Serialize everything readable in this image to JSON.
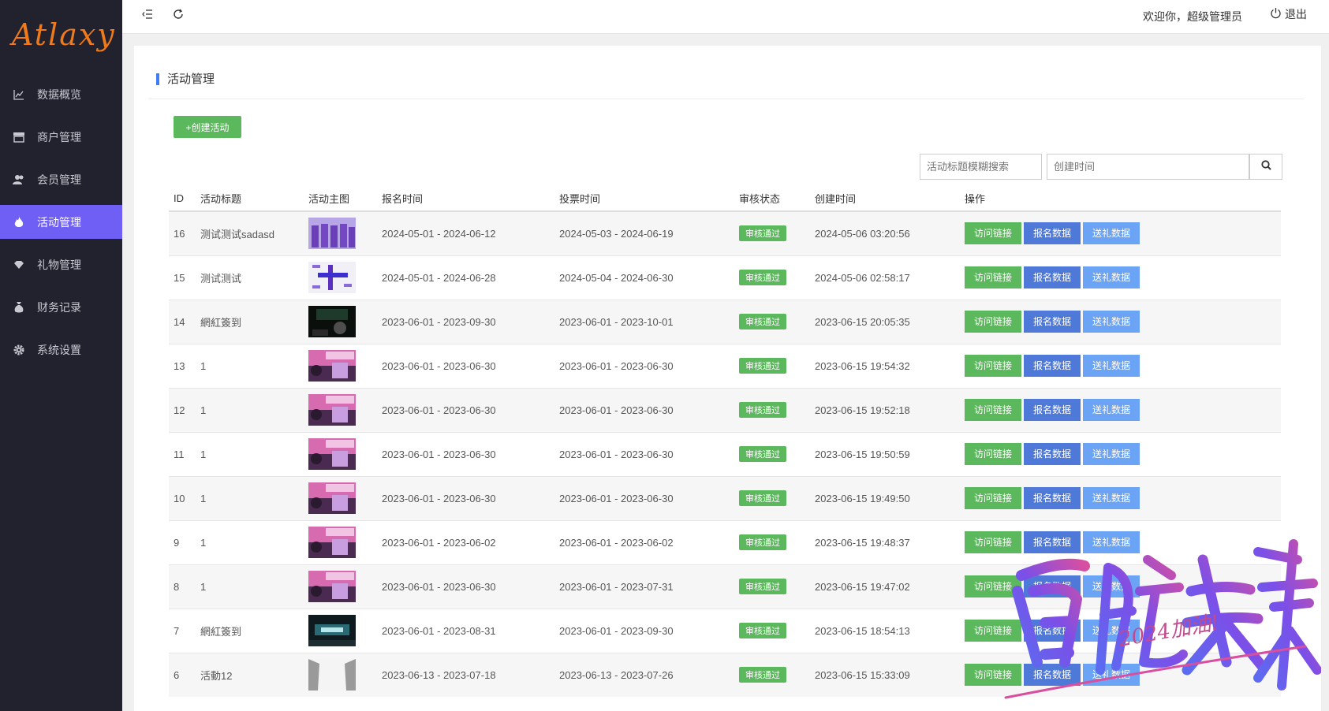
{
  "brand": "Atlaxy",
  "sidebar": {
    "items": [
      {
        "label": "数据概览",
        "icon": "chart-line-icon",
        "active": false
      },
      {
        "label": "商户管理",
        "icon": "store-icon",
        "active": false
      },
      {
        "label": "会员管理",
        "icon": "users-icon",
        "active": false
      },
      {
        "label": "活动管理",
        "icon": "fire-icon",
        "active": true
      },
      {
        "label": "礼物管理",
        "icon": "diamond-icon",
        "active": false
      },
      {
        "label": "财务记录",
        "icon": "money-bag-icon",
        "active": false
      },
      {
        "label": "系统设置",
        "icon": "gear-icon",
        "active": false
      }
    ]
  },
  "header": {
    "welcome": "欢迎你，超级管理员",
    "logout": "退出"
  },
  "page": {
    "title": "活动管理",
    "create_label": "+创建活动",
    "search_title_placeholder": "活动标题模糊搜索",
    "search_time_placeholder": "创建时间"
  },
  "table": {
    "columns": [
      "ID",
      "活动标题",
      "活动主图",
      "报名时间",
      "投票时间",
      "审核状态",
      "创建时间",
      "操作"
    ],
    "actions": [
      "访问链接",
      "报名数据",
      "送礼数据"
    ],
    "rows": [
      {
        "id": "16",
        "title": "测试测试sadasd",
        "thumb": "purple-group",
        "signup": "2024-05-01 - 2024-06-12",
        "vote": "2024-05-03 - 2024-06-19",
        "status": "审核通过",
        "created": "2024-05-06 03:20:56"
      },
      {
        "id": "15",
        "title": "测试测试",
        "thumb": "diagram",
        "signup": "2024-05-01 - 2024-06-28",
        "vote": "2024-05-04 - 2024-06-30",
        "status": "审核通过",
        "created": "2024-05-06 02:58:17"
      },
      {
        "id": "14",
        "title": "網紅簽到",
        "thumb": "dark-green",
        "signup": "2023-06-01 - 2023-09-30",
        "vote": "2023-06-01 - 2023-10-01",
        "status": "审核通过",
        "created": "2023-06-15 20:05:35"
      },
      {
        "id": "13",
        "title": "1",
        "thumb": "pink-stage",
        "signup": "2023-06-01 - 2023-06-30",
        "vote": "2023-06-01 - 2023-06-30",
        "status": "审核通过",
        "created": "2023-06-15 19:54:32"
      },
      {
        "id": "12",
        "title": "1",
        "thumb": "pink-stage",
        "signup": "2023-06-01 - 2023-06-30",
        "vote": "2023-06-01 - 2023-06-30",
        "status": "审核通过",
        "created": "2023-06-15 19:52:18"
      },
      {
        "id": "11",
        "title": "1",
        "thumb": "pink-stage",
        "signup": "2023-06-01 - 2023-06-30",
        "vote": "2023-06-01 - 2023-06-30",
        "status": "审核通过",
        "created": "2023-06-15 19:50:59"
      },
      {
        "id": "10",
        "title": "1",
        "thumb": "pink-stage",
        "signup": "2023-06-01 - 2023-06-30",
        "vote": "2023-06-01 - 2023-06-30",
        "status": "审核通过",
        "created": "2023-06-15 19:49:50"
      },
      {
        "id": "9",
        "title": "1",
        "thumb": "pink-stage",
        "signup": "2023-06-01 - 2023-06-02",
        "vote": "2023-06-01 - 2023-06-02",
        "status": "审核通过",
        "created": "2023-06-15 19:48:37"
      },
      {
        "id": "8",
        "title": "1",
        "thumb": "pink-stage",
        "signup": "2023-06-01 - 2023-06-30",
        "vote": "2023-06-01 - 2023-07-31",
        "status": "审核通过",
        "created": "2023-06-15 19:47:02"
      },
      {
        "id": "7",
        "title": "網紅簽到",
        "thumb": "dark-teal",
        "signup": "2023-06-01 - 2023-08-31",
        "vote": "2023-06-01 - 2023-09-30",
        "status": "审核通过",
        "created": "2023-06-15 18:54:13"
      },
      {
        "id": "6",
        "title": "活動12",
        "thumb": "gray",
        "signup": "2023-06-13 - 2023-07-18",
        "vote": "2023-06-13 - 2023-07-26",
        "status": "审核通过",
        "created": "2023-06-15 15:33:09"
      }
    ]
  },
  "watermark": {
    "main": "启航未来",
    "sub": "2024加油!"
  },
  "colors": {
    "sidebar_bg": "#22222e",
    "accent": "#6f5ff5",
    "brand": "#f07a1a",
    "success": "#5cb85c",
    "primary": "#4f79d9",
    "info": "#6ba3f5"
  }
}
